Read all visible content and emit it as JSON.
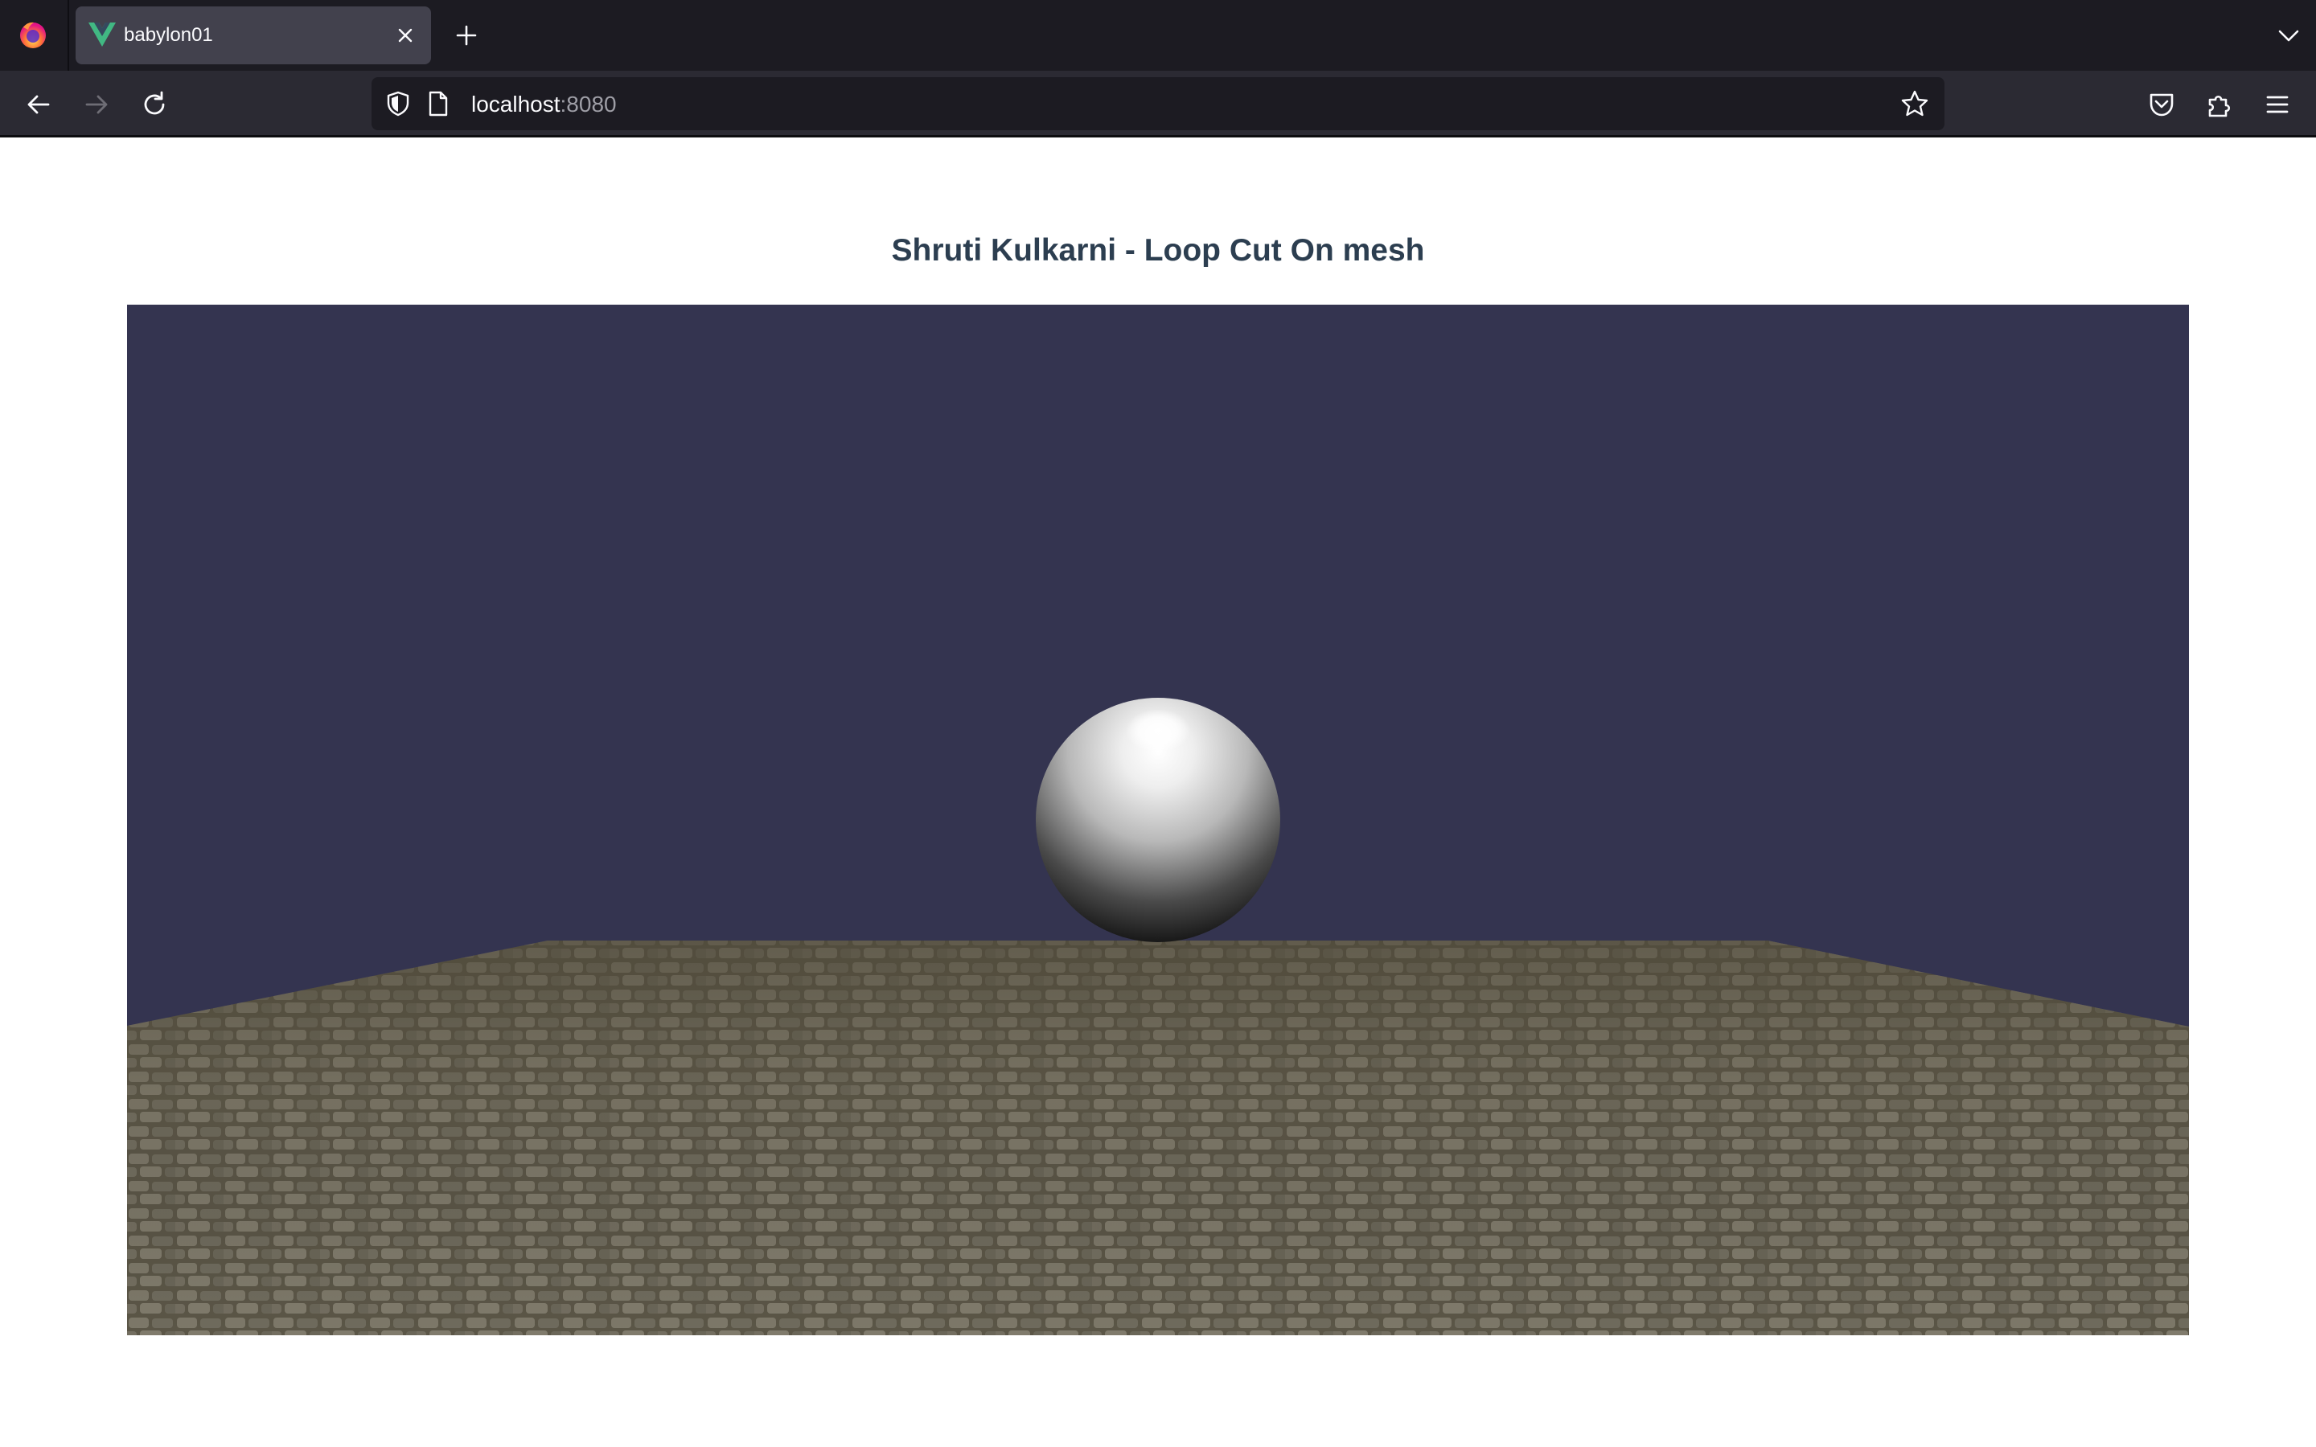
{
  "browser": {
    "tab": {
      "title": "babylon01"
    },
    "address": {
      "host": "localhost",
      "port": ":8080"
    }
  },
  "page": {
    "title": "Shruti Kulkarni - Loop Cut On mesh"
  },
  "scene": {
    "background_color": "#343450",
    "ground_texture": "cobblestone",
    "object": "sphere"
  },
  "icons": {
    "browser_logo": "firefox-icon",
    "tab_favicon": "vue-icon",
    "tab_close": "close-icon",
    "new_tab": "plus-icon",
    "tab_list": "chevron-down-icon",
    "back": "arrow-left-icon",
    "forward": "arrow-right-icon",
    "reload": "reload-icon",
    "tracking": "shield-icon",
    "page_info": "page-icon",
    "bookmark": "star-icon",
    "pocket": "pocket-icon",
    "extensions": "puzzle-icon",
    "menu": "hamburger-icon"
  }
}
